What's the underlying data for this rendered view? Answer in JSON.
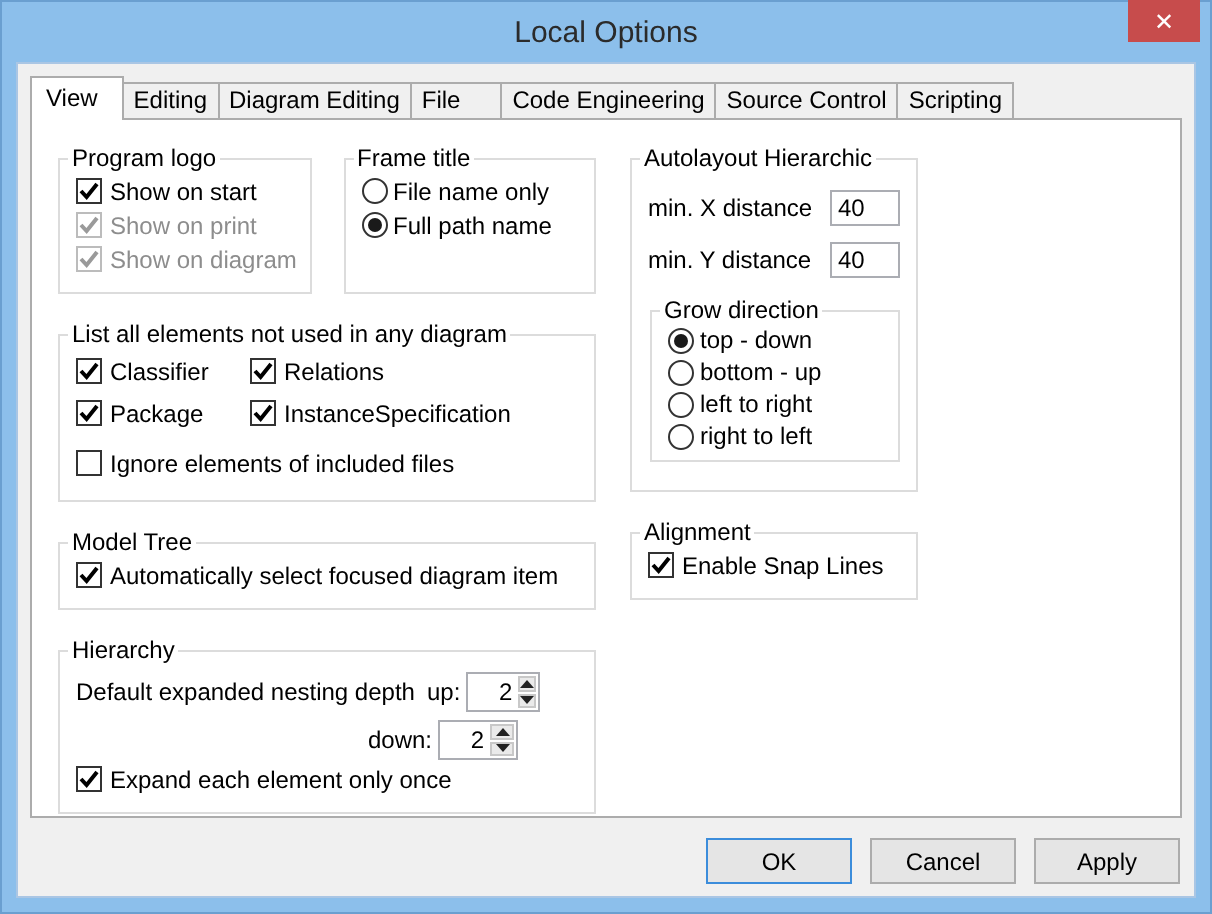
{
  "window": {
    "title": "Local Options",
    "close_label": "✕"
  },
  "tabs": [
    {
      "label": "View",
      "selected": true
    },
    {
      "label": "Editing",
      "selected": false
    },
    {
      "label": "Diagram Editing",
      "selected": false
    },
    {
      "label": "File",
      "selected": false
    },
    {
      "label": "Code Engineering",
      "selected": false
    },
    {
      "label": "Source Control",
      "selected": false
    },
    {
      "label": "Scripting",
      "selected": false
    }
  ],
  "panel": {
    "columns": [
      {
        "groups": [
          {
            "kind": "row",
            "groups": [
              {
                "kind": "box",
                "title": "Program logo",
                "items": [
                  {
                    "kind": "checkbox",
                    "label": "Show on start",
                    "checked": true,
                    "disabled": false
                  },
                  {
                    "kind": "checkbox",
                    "label": "Show on print",
                    "checked": true,
                    "disabled": true
                  },
                  {
                    "kind": "checkbox",
                    "label": "Show on diagram",
                    "checked": true,
                    "disabled": true
                  }
                ]
              },
              {
                "kind": "box",
                "title": "Frame title",
                "items": [
                  {
                    "kind": "radio",
                    "label": "File name only",
                    "selected": false
                  },
                  {
                    "kind": "radio",
                    "label": "Full path name",
                    "selected": true
                  }
                ]
              }
            ]
          },
          {
            "kind": "box",
            "title": "List all elements not used in any diagram",
            "items": [
              {
                "kind": "pair",
                "items": [
                  {
                    "kind": "checkbox",
                    "label": "Classifier",
                    "checked": true,
                    "disabled": false
                  },
                  {
                    "kind": "checkbox",
                    "label": "Relations",
                    "checked": true,
                    "disabled": false
                  }
                ]
              },
              {
                "kind": "pair",
                "items": [
                  {
                    "kind": "checkbox",
                    "label": "Package",
                    "checked": true,
                    "disabled": false
                  },
                  {
                    "kind": "checkbox",
                    "label": "InstanceSpecification",
                    "checked": true,
                    "disabled": false
                  }
                ]
              },
              {
                "kind": "checkbox",
                "label": "Ignore elements of included files",
                "checked": false,
                "disabled": false
              }
            ]
          },
          {
            "kind": "box",
            "title": "Model Tree",
            "items": [
              {
                "kind": "checkbox",
                "label": "Automatically select focused diagram item",
                "checked": true,
                "disabled": false
              }
            ]
          },
          {
            "kind": "box",
            "title": "Hierarchy",
            "items": [
              {
                "kind": "spinner",
                "label": "Default expanded nesting depth",
                "sublabel": "up:",
                "value": "2"
              },
              {
                "kind": "spinner",
                "sublabel": "down:",
                "value": "2"
              },
              {
                "kind": "checkbox",
                "label": "Expand each element only once",
                "checked": true,
                "disabled": false
              }
            ]
          }
        ]
      },
      {
        "groups": [
          {
            "kind": "box",
            "title": "Autolayout Hierarchic",
            "items": [
              {
                "kind": "field",
                "label": "min. X distance",
                "value": "40"
              },
              {
                "kind": "field",
                "label": "min. Y distance",
                "value": "40"
              },
              {
                "kind": "group",
                "title": "Grow direction",
                "items": [
                  {
                    "kind": "radio",
                    "label": "top - down",
                    "selected": true
                  },
                  {
                    "kind": "radio",
                    "label": "bottom - up",
                    "selected": false
                  },
                  {
                    "kind": "radio",
                    "label": "left to right",
                    "selected": false
                  },
                  {
                    "kind": "radio",
                    "label": "right to left",
                    "selected": false
                  }
                ]
              }
            ]
          },
          {
            "kind": "box",
            "title": "Alignment",
            "items": [
              {
                "kind": "checkbox",
                "label": "Enable Snap Lines",
                "checked": true,
                "disabled": false
              }
            ]
          }
        ]
      }
    ]
  },
  "buttons": [
    {
      "label": "OK",
      "default": true
    },
    {
      "label": "Cancel",
      "default": false
    },
    {
      "label": "Apply",
      "default": false
    }
  ]
}
